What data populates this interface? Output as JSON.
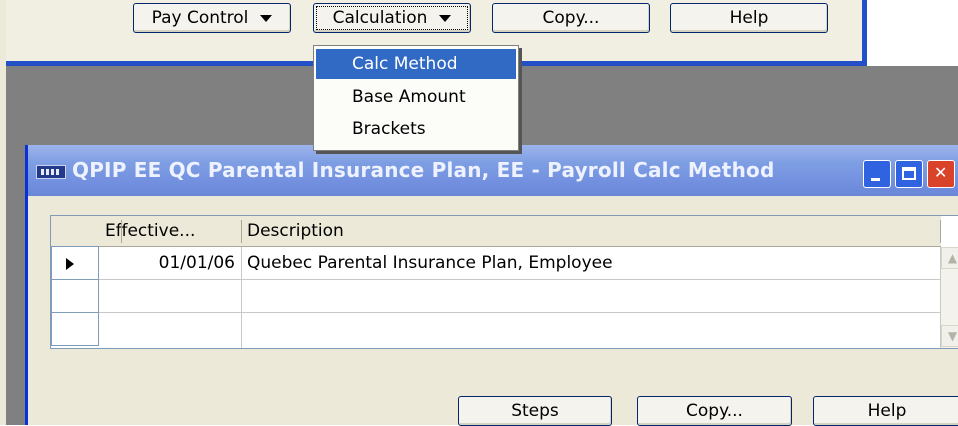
{
  "background_window": {
    "buttons": [
      {
        "label": "Pay Control",
        "has_dropdown": true
      },
      {
        "label": "Calculation",
        "has_dropdown": true
      },
      {
        "label": "Copy...",
        "has_dropdown": false
      },
      {
        "label": "Help",
        "has_dropdown": false
      }
    ]
  },
  "calculation_menu": {
    "items": [
      {
        "label": "Calc Method",
        "selected": true
      },
      {
        "label": "Base Amount",
        "selected": false
      },
      {
        "label": "Brackets",
        "selected": false
      }
    ]
  },
  "window": {
    "title": "QPIP EE QC Parental Insurance Plan, EE - Payroll Calc Method",
    "grid": {
      "columns": [
        "Effective...",
        "Description"
      ],
      "rows": [
        {
          "effective": "01/01/06",
          "description": "Quebec Parental Insurance Plan, Employee",
          "current": true
        },
        {
          "effective": "",
          "description": "",
          "current": false
        },
        {
          "effective": "",
          "description": "",
          "current": false
        }
      ]
    },
    "buttons": [
      {
        "label": "Steps"
      },
      {
        "label": "Copy..."
      },
      {
        "label": "Help"
      }
    ]
  },
  "colors": {
    "title_bar": "#7e9ee3",
    "window_border": "#0831d9",
    "menu_highlight": "#316ac5",
    "desktop_gray": "#808080"
  }
}
